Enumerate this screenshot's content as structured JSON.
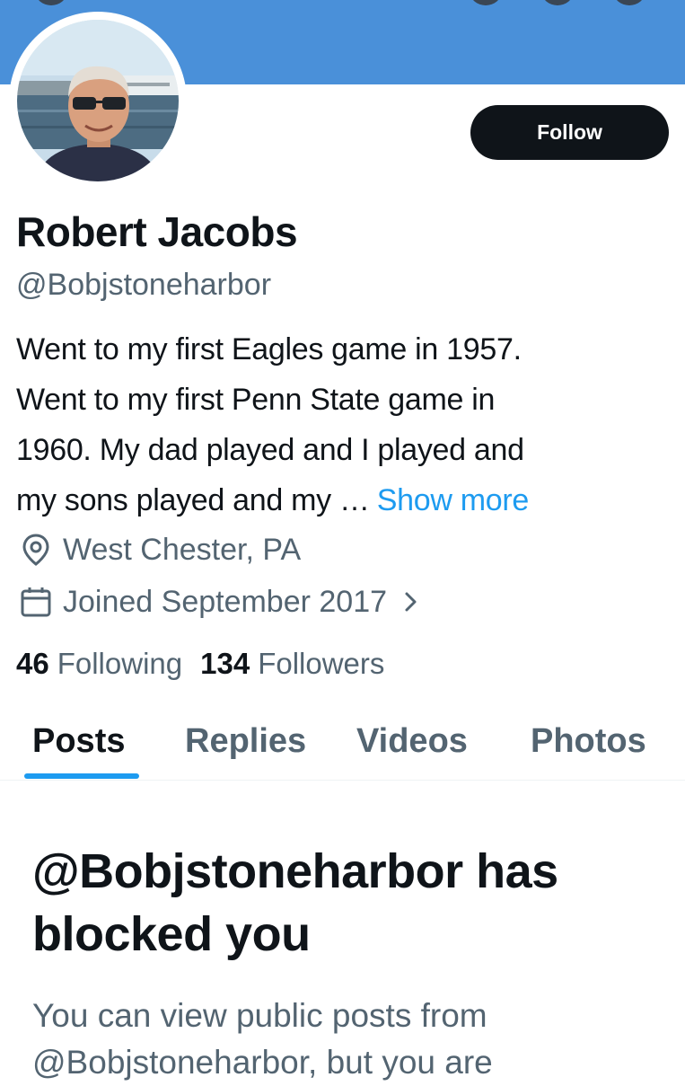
{
  "profile": {
    "name": "Robert Jacobs",
    "handle": "@Bobjstoneharbor",
    "follow_label": "Follow",
    "bio_lines": [
      "Went to my first Eagles game in 1957.",
      "Went to my first Penn State game in",
      "1960. My dad played and I played and",
      "my sons played and my …"
    ],
    "show_more_label": "Show more",
    "location": "West Chester, PA",
    "joined": "Joined September 2017"
  },
  "stats": {
    "following_count": "46",
    "following_label": "Following",
    "followers_count": "134",
    "followers_label": "Followers"
  },
  "tabs": [
    {
      "label": "Posts",
      "active": true
    },
    {
      "label": "Replies",
      "active": false
    },
    {
      "label": "Videos",
      "active": false
    },
    {
      "label": "Photos",
      "active": false
    }
  ],
  "blocked": {
    "title": "@Bobjstoneharbor has blocked you",
    "message": "You can view public posts from @Bobjstoneharbor, but you are"
  },
  "icons": {
    "location": "location-pin-icon",
    "calendar": "calendar-icon",
    "chevron": "chevron-right-icon"
  },
  "colors": {
    "banner": "#4a90d9",
    "accent": "#1d9bf0",
    "primary_text": "#0f1419",
    "secondary_text": "#536471",
    "follow_button": "#0f1419"
  }
}
